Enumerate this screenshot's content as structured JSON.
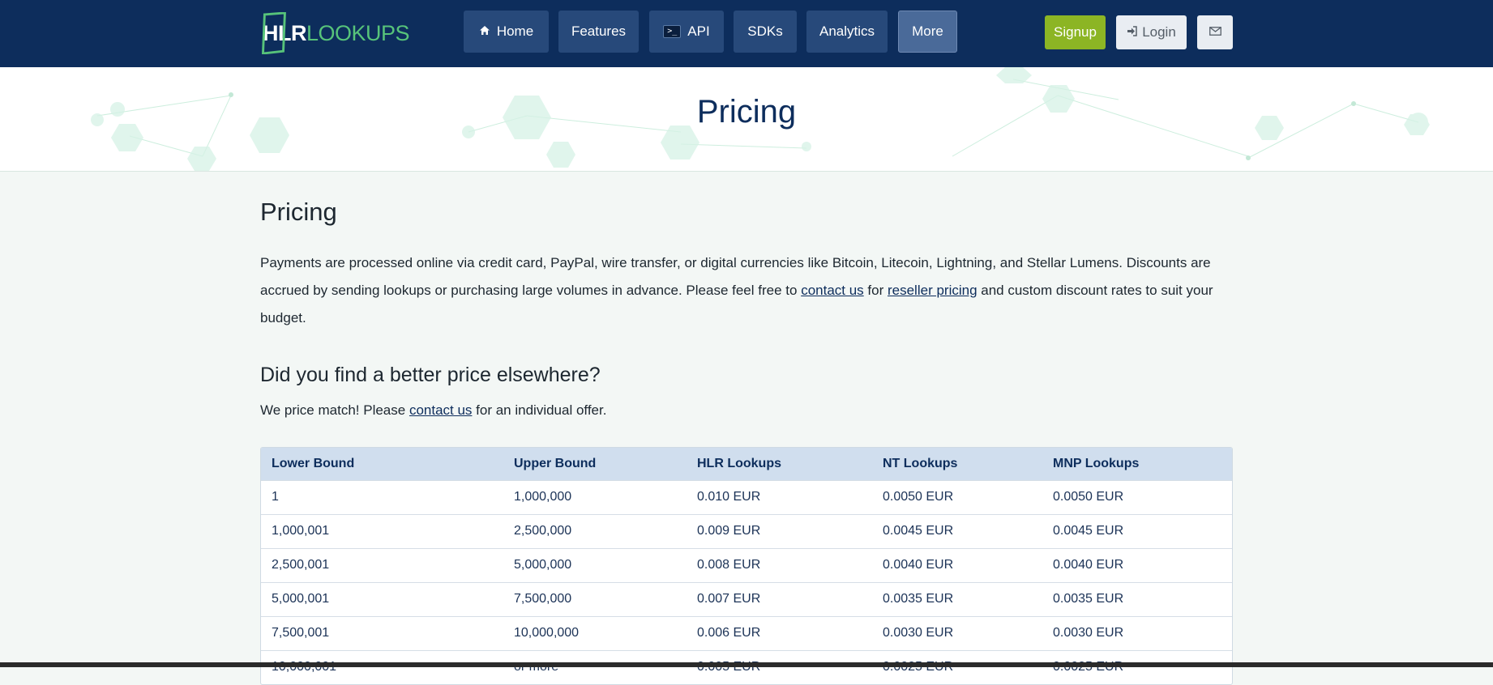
{
  "nav": {
    "logo": {
      "part1": "HLR",
      "part2": "LOOKUPS"
    },
    "items": [
      {
        "label": "Home",
        "icon": "home-icon"
      },
      {
        "label": "Features",
        "icon": ""
      },
      {
        "label": "API",
        "icon": "terminal-icon"
      },
      {
        "label": "SDKs",
        "icon": ""
      },
      {
        "label": "Analytics",
        "icon": ""
      },
      {
        "label": "More",
        "icon": ""
      }
    ],
    "signup_label": "Signup",
    "login_label": "Login"
  },
  "hero": {
    "title": "Pricing"
  },
  "main": {
    "heading": "Pricing",
    "intro_part1": "Payments are processed online via credit card, PayPal, wire transfer, or digital currencies like Bitcoin, Litecoin, Lightning, and Stellar Lumens. Discounts are accrued by sending lookups or purchasing large volumes in advance. Please feel free to ",
    "intro_link1": "contact us",
    "intro_part2": " for ",
    "intro_link2": "reseller pricing",
    "intro_part3": " and custom discount rates to suit your budget.",
    "price_match_heading": "Did you find a better price elsewhere?",
    "price_match_part1": "We price match! Please ",
    "price_match_link": "contact us",
    "price_match_part2": " for an individual offer."
  },
  "table": {
    "headers": [
      "Lower Bound",
      "Upper Bound",
      "HLR Lookups",
      "NT Lookups",
      "MNP Lookups"
    ],
    "rows": [
      [
        "1",
        "1,000,000",
        "0.010 EUR",
        "0.0050 EUR",
        "0.0050 EUR"
      ],
      [
        "1,000,001",
        "2,500,000",
        "0.009 EUR",
        "0.0045 EUR",
        "0.0045 EUR"
      ],
      [
        "2,500,001",
        "5,000,000",
        "0.008 EUR",
        "0.0040 EUR",
        "0.0040 EUR"
      ],
      [
        "5,000,001",
        "7,500,000",
        "0.007 EUR",
        "0.0035 EUR",
        "0.0035 EUR"
      ],
      [
        "7,500,001",
        "10,000,000",
        "0.006 EUR",
        "0.0030 EUR",
        "0.0030 EUR"
      ],
      [
        "10,000,001",
        "or more",
        "0.005 EUR",
        "0.0025 EUR",
        "0.0025 EUR"
      ]
    ]
  },
  "colors": {
    "navbar": "#0d2d5c",
    "nav_button": "#27497a",
    "signup": "#8cb524",
    "brand_green": "#57c37a",
    "table_header": "#d0deee"
  }
}
